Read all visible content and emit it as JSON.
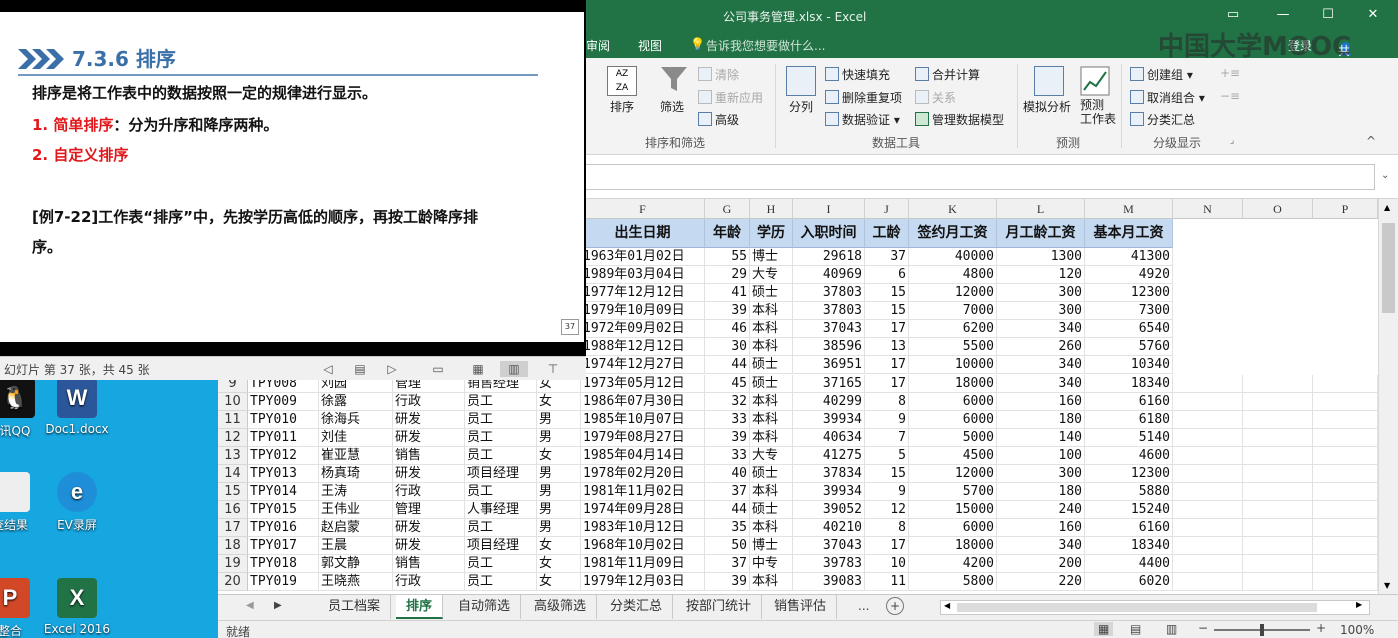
{
  "desktop": {
    "icons": [
      {
        "label": "讯QQ",
        "name": "qq"
      },
      {
        "label": "Doc1.docx",
        "name": "doc1-docx"
      },
      {
        "label": "查结果",
        "name": "results"
      },
      {
        "label": "EV录屏",
        "name": "ev-recorder"
      },
      {
        "label": "整合",
        "name": "merge"
      },
      {
        "label": "Excel 2016",
        "name": "excel-2016"
      }
    ]
  },
  "excel": {
    "title": "公司事务管理.xlsx - Excel",
    "tabs": [
      "审阅",
      "视图"
    ],
    "tell_me": "告诉我您想要做什么...",
    "login": "登录",
    "share": "共享",
    "ribbon": {
      "sort_label": "排序",
      "filter_label": "筛选",
      "clear": "清除",
      "reapply": "重新应用",
      "advanced": "高级",
      "group_sort_filter": "排序和筛选",
      "split": "分列",
      "flash_fill": "快速填充",
      "remove_dup": "删除重复项",
      "data_validation": "数据验证",
      "consolidate": "合并计算",
      "relations": "关系",
      "data_model": "管理数据模型",
      "group_data_tools": "数据工具",
      "whatif": "模拟分析",
      "forecast_sheet": "预测\n工作表",
      "group_forecast": "预测",
      "create_group": "创建组",
      "ungroup": "取消组合",
      "subtotal": "分类汇总",
      "group_outline": "分级显示"
    },
    "columns": [
      "F",
      "G",
      "H",
      "I",
      "J",
      "K",
      "L",
      "M",
      "N",
      "O",
      "P"
    ],
    "headers": [
      "出生日期",
      "年龄",
      "学历",
      "入职时间",
      "工龄",
      "签约月工资",
      "月工龄工资",
      "基本月工资"
    ],
    "top_rows": [
      [
        "1963年01月02日",
        "55",
        "博士",
        "29618",
        "37",
        "40000",
        "1300",
        "41300"
      ],
      [
        "1989年03月04日",
        "29",
        "大专",
        "40969",
        "6",
        "4800",
        "120",
        "4920"
      ],
      [
        "1977年12月12日",
        "41",
        "硕士",
        "37803",
        "15",
        "12000",
        "300",
        "12300"
      ],
      [
        "1979年10月09日",
        "39",
        "本科",
        "37803",
        "15",
        "7000",
        "300",
        "7300"
      ],
      [
        "1972年09月02日",
        "46",
        "本科",
        "37043",
        "17",
        "6200",
        "340",
        "6540"
      ],
      [
        "1988年12月12日",
        "30",
        "本科",
        "38596",
        "13",
        "5500",
        "260",
        "5760"
      ],
      [
        "1974年12月27日",
        "44",
        "硕士",
        "36951",
        "17",
        "10000",
        "340",
        "10340"
      ]
    ],
    "rows": [
      {
        "n": "9",
        "id": "TPY008",
        "name": "刘园",
        "dept": "管理",
        "pos": "销售经理",
        "sex": "女",
        "birth": "1973年05月12日",
        "age": "45",
        "edu": "硕士",
        "hire": "37165",
        "yrs": "17",
        "sal": "18000",
        "yrpay": "340",
        "base": "18340"
      },
      {
        "n": "10",
        "id": "TPY009",
        "name": "徐露",
        "dept": "行政",
        "pos": "员工",
        "sex": "女",
        "birth": "1986年07月30日",
        "age": "32",
        "edu": "本科",
        "hire": "40299",
        "yrs": "8",
        "sal": "6000",
        "yrpay": "160",
        "base": "6160"
      },
      {
        "n": "11",
        "id": "TPY010",
        "name": "徐海兵",
        "dept": "研发",
        "pos": "员工",
        "sex": "男",
        "birth": "1985年10月07日",
        "age": "33",
        "edu": "本科",
        "hire": "39934",
        "yrs": "9",
        "sal": "6000",
        "yrpay": "180",
        "base": "6180"
      },
      {
        "n": "12",
        "id": "TPY011",
        "name": "刘佳",
        "dept": "研发",
        "pos": "员工",
        "sex": "男",
        "birth": "1979年08月27日",
        "age": "39",
        "edu": "本科",
        "hire": "40634",
        "yrs": "7",
        "sal": "5000",
        "yrpay": "140",
        "base": "5140"
      },
      {
        "n": "13",
        "id": "TPY012",
        "name": "崔亚慧",
        "dept": "销售",
        "pos": "员工",
        "sex": "女",
        "birth": "1985年04月14日",
        "age": "33",
        "edu": "大专",
        "hire": "41275",
        "yrs": "5",
        "sal": "4500",
        "yrpay": "100",
        "base": "4600"
      },
      {
        "n": "14",
        "id": "TPY013",
        "name": "杨真琦",
        "dept": "研发",
        "pos": "项目经理",
        "sex": "男",
        "birth": "1978年02月20日",
        "age": "40",
        "edu": "硕士",
        "hire": "37834",
        "yrs": "15",
        "sal": "12000",
        "yrpay": "300",
        "base": "12300"
      },
      {
        "n": "15",
        "id": "TPY014",
        "name": "王涛",
        "dept": "行政",
        "pos": "员工",
        "sex": "男",
        "birth": "1981年11月02日",
        "age": "37",
        "edu": "本科",
        "hire": "39934",
        "yrs": "9",
        "sal": "5700",
        "yrpay": "180",
        "base": "5880"
      },
      {
        "n": "16",
        "id": "TPY015",
        "name": "王伟业",
        "dept": "管理",
        "pos": "人事经理",
        "sex": "男",
        "birth": "1974年09月28日",
        "age": "44",
        "edu": "硕士",
        "hire": "39052",
        "yrs": "12",
        "sal": "15000",
        "yrpay": "240",
        "base": "15240"
      },
      {
        "n": "17",
        "id": "TPY016",
        "name": "赵启蒙",
        "dept": "研发",
        "pos": "员工",
        "sex": "男",
        "birth": "1983年10月12日",
        "age": "35",
        "edu": "本科",
        "hire": "40210",
        "yrs": "8",
        "sal": "6000",
        "yrpay": "160",
        "base": "6160"
      },
      {
        "n": "18",
        "id": "TPY017",
        "name": "王晨",
        "dept": "研发",
        "pos": "项目经理",
        "sex": "女",
        "birth": "1968年10月02日",
        "age": "50",
        "edu": "博士",
        "hire": "37043",
        "yrs": "17",
        "sal": "18000",
        "yrpay": "340",
        "base": "18340"
      },
      {
        "n": "19",
        "id": "TPY018",
        "name": "郭文静",
        "dept": "销售",
        "pos": "员工",
        "sex": "女",
        "birth": "1981年11月09日",
        "age": "37",
        "edu": "中专",
        "hire": "39783",
        "yrs": "10",
        "sal": "4200",
        "yrpay": "200",
        "base": "4400"
      },
      {
        "n": "20",
        "id": "TPY019",
        "name": "王晓燕",
        "dept": "行政",
        "pos": "员工",
        "sex": "女",
        "birth": "1979年12月03日",
        "age": "39",
        "edu": "本科",
        "hire": "39083",
        "yrs": "11",
        "sal": "5800",
        "yrpay": "220",
        "base": "6020"
      }
    ],
    "sheets": [
      "员工档案",
      "排序",
      "自动筛选",
      "高级筛选",
      "分类汇总",
      "按部门统计",
      "销售评估"
    ],
    "active_sheet": "排序",
    "more_sheets": "...",
    "status": "就绪",
    "zoom": "100%"
  },
  "ppt": {
    "title": "7.3.6  排序",
    "line1": "排序是将工作表中的数据按照一定的规律进行显示。",
    "line2_red": "1. 简单排序",
    "line2_rest": "：分为升序和降序两种。",
    "line3_red": "2. 自定义排序",
    "line4": "[例7-22]工作表“排序”中，先按学历高低的顺序，再按工龄降序排",
    "line5": "序。",
    "page_no": "37",
    "status": "幻灯片 第 37 张，共 45 张"
  },
  "watermark": "中国大学MOOC",
  "colors": {
    "excel_green": "#217346",
    "header_fill": "#c5d9f1",
    "title_blue": "#3a6fa8",
    "red": "#e0171b"
  }
}
